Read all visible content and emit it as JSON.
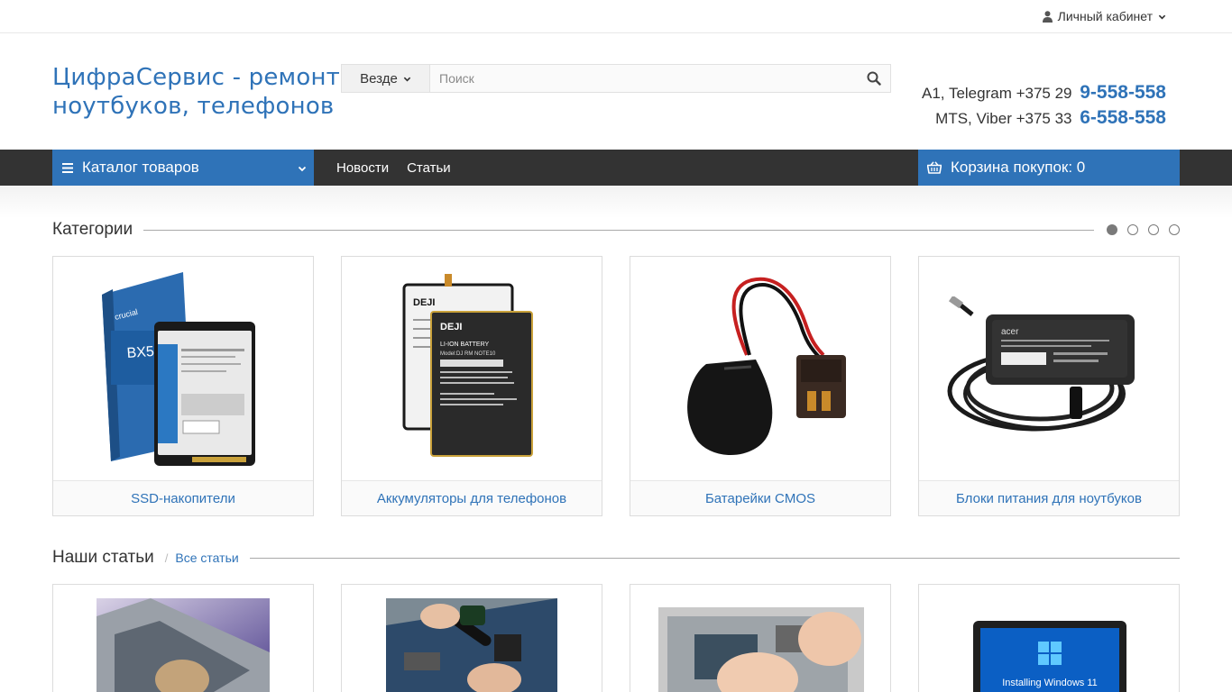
{
  "topbar": {
    "account_label": "Личный кабинет",
    "account_icon": "user-icon"
  },
  "header": {
    "logo_line1": "ЦифраСервис - ремонт",
    "logo_line2": "ноутбуков, телефонов",
    "search": {
      "scope": "Везде",
      "placeholder": "Поиск",
      "value": ""
    },
    "phones": [
      {
        "prefix": "A1, Telegram +375 29",
        "number": "9-558-558"
      },
      {
        "prefix": "MTS, Viber +375 33",
        "number": "6-558-558"
      }
    ]
  },
  "nav": {
    "catalog_label": "Каталог товаров",
    "links": [
      "Новости",
      "Статьи"
    ],
    "cart_label": "Корзина покупок: 0"
  },
  "categories": {
    "title": "Категории",
    "carousel_pages": 4,
    "active_page": 1,
    "items": [
      {
        "label": "SSD-накопители",
        "icon": "ssd-image"
      },
      {
        "label": "Аккумуляторы для телефонов",
        "icon": "phone-battery-image"
      },
      {
        "label": "Батарейки CMOS",
        "icon": "cmos-battery-image"
      },
      {
        "label": "Блоки питания для ноутбуков",
        "icon": "laptop-charger-image"
      }
    ]
  },
  "articles": {
    "title": "Наши статьи",
    "separator": "/",
    "all_link": "Все статьи",
    "items": [
      {
        "icon": "laptop-repair-image"
      },
      {
        "icon": "motherboard-screwdriver-image"
      },
      {
        "icon": "laptop-disassembly-image"
      },
      {
        "icon": "windows-install-image",
        "screen_text": "Installing Windows 11"
      }
    ]
  },
  "colors": {
    "accent": "#2f73b8",
    "nav_bg": "#333333"
  }
}
